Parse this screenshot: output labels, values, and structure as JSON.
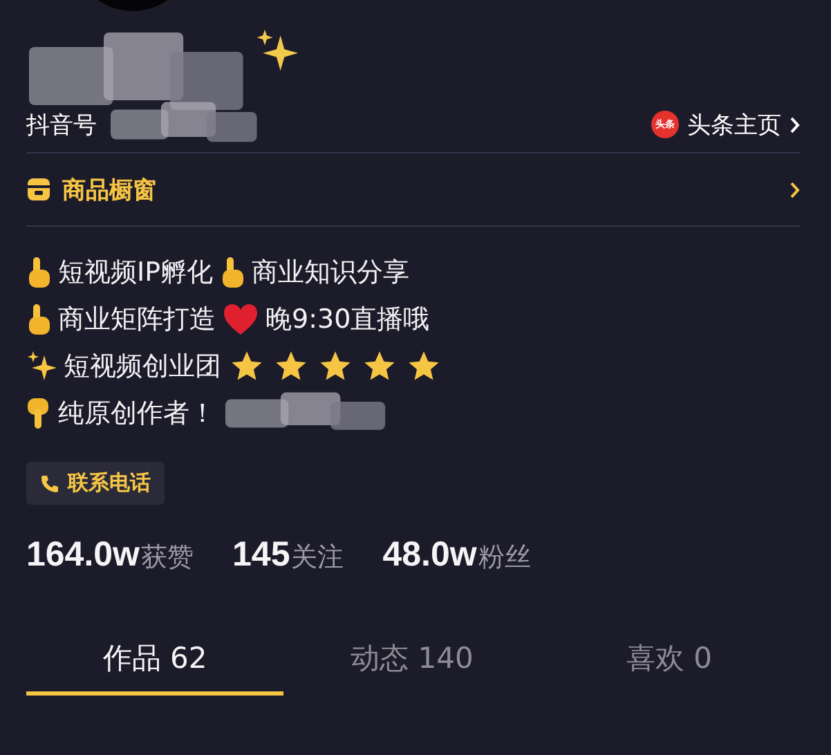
{
  "account": {
    "id_label": "抖音号",
    "toutiao_link": "头条主页",
    "toutiao_badge": "头条"
  },
  "shop": {
    "label": "商品橱窗"
  },
  "bio": [
    {
      "segments": [
        {
          "kind": "point-up"
        },
        {
          "kind": "text",
          "text": "短视频IP孵化"
        },
        {
          "kind": "point-up"
        },
        {
          "kind": "text",
          "text": "商业知识分享"
        }
      ]
    },
    {
      "segments": [
        {
          "kind": "point-up"
        },
        {
          "kind": "text",
          "text": "商业矩阵打造"
        },
        {
          "kind": "heart"
        },
        {
          "kind": "text",
          "text": "晚9:30直播哦"
        }
      ]
    },
    {
      "segments": [
        {
          "kind": "sparkles"
        },
        {
          "kind": "text",
          "text": "短视频创业团"
        },
        {
          "kind": "star"
        },
        {
          "kind": "star"
        },
        {
          "kind": "star"
        },
        {
          "kind": "star"
        },
        {
          "kind": "star"
        }
      ]
    },
    {
      "segments": [
        {
          "kind": "point-down"
        },
        {
          "kind": "text",
          "text": "纯原创作者！"
        },
        {
          "kind": "redacted"
        }
      ]
    }
  ],
  "contact": {
    "label": "联系电话"
  },
  "stats": [
    {
      "count": "164.0w",
      "unit": "获赞"
    },
    {
      "count": "145",
      "unit": "关注"
    },
    {
      "count": "48.0w",
      "unit": "粉丝"
    }
  ],
  "tabs": [
    {
      "label": "作品 62",
      "selected": true
    },
    {
      "label": "动态 140",
      "selected": false
    },
    {
      "label": "喜欢 0",
      "selected": false
    }
  ]
}
